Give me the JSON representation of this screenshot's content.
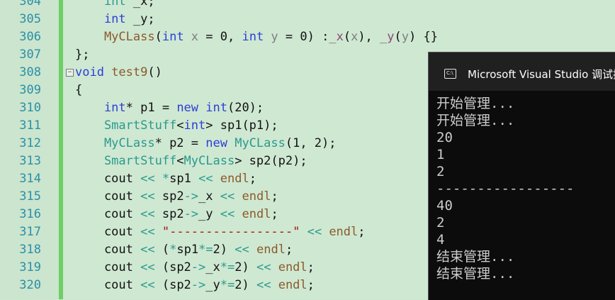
{
  "editor": {
    "lines": [
      {
        "no": "304",
        "tokens": [
          [
            "ty",
            "    int "
          ],
          [
            "pl",
            "_x;"
          ]
        ]
      },
      {
        "no": "305",
        "tokens": [
          [
            "kw",
            "    int "
          ],
          [
            "pl",
            "_y;"
          ]
        ]
      },
      {
        "no": "306",
        "tokens": [
          [
            "fn",
            "    MyCLass"
          ],
          [
            "pl",
            "("
          ],
          [
            "kw",
            "int "
          ],
          [
            "pm",
            "x"
          ],
          [
            "pl",
            " = 0, "
          ],
          [
            "kw",
            "int "
          ],
          [
            "pm",
            "y"
          ],
          [
            "pl",
            " = 0) :"
          ],
          [
            "mb",
            "_x"
          ],
          [
            "pl",
            "("
          ],
          [
            "pm",
            "x"
          ],
          [
            "pl",
            "), "
          ],
          [
            "mb",
            "_y"
          ],
          [
            "pl",
            "("
          ],
          [
            "pm",
            "y"
          ],
          [
            "pl",
            ") {}"
          ]
        ]
      },
      {
        "no": "307",
        "tokens": [
          [
            "pl",
            "};"
          ]
        ]
      },
      {
        "no": "308",
        "tokens": [
          [
            "kw",
            "void "
          ],
          [
            "fn",
            "test9"
          ],
          [
            "pl",
            "()"
          ]
        ]
      },
      {
        "no": "309",
        "tokens": [
          [
            "pl",
            "{"
          ]
        ]
      },
      {
        "no": "310",
        "tokens": [
          [
            "kw",
            "    int"
          ],
          [
            "pl",
            "* p1 = "
          ],
          [
            "kw",
            "new int"
          ],
          [
            "pl",
            "(20);"
          ]
        ]
      },
      {
        "no": "311",
        "tokens": [
          [
            "ty",
            "    SmartStuff"
          ],
          [
            "pl",
            "<"
          ],
          [
            "kw",
            "int"
          ],
          [
            "pl",
            "> sp1(p1);"
          ]
        ]
      },
      {
        "no": "312",
        "tokens": [
          [
            "ty",
            "    MyCLass"
          ],
          [
            "pl",
            "* p2 = "
          ],
          [
            "kw",
            "new "
          ],
          [
            "ty",
            "MyCLass"
          ],
          [
            "pl",
            "(1, 2);"
          ]
        ]
      },
      {
        "no": "313",
        "tokens": [
          [
            "ty",
            "    SmartStuff"
          ],
          [
            "pl",
            "<"
          ],
          [
            "ty",
            "MyCLass"
          ],
          [
            "pl",
            "> sp2(p2);"
          ]
        ]
      },
      {
        "no": "314",
        "tokens": [
          [
            "pl",
            "    cout "
          ],
          [
            "ty",
            "<<"
          ],
          [
            "pl",
            " "
          ],
          [
            "ty",
            "*"
          ],
          [
            "pl",
            "sp1 "
          ],
          [
            "ty",
            "<<"
          ],
          [
            "pl",
            " "
          ],
          [
            "fn",
            "endl"
          ],
          [
            "pl",
            ";"
          ]
        ]
      },
      {
        "no": "315",
        "tokens": [
          [
            "pl",
            "    cout "
          ],
          [
            "ty",
            "<<"
          ],
          [
            "pl",
            " sp2"
          ],
          [
            "ty",
            "->"
          ],
          [
            "pl",
            "_x "
          ],
          [
            "ty",
            "<<"
          ],
          [
            "pl",
            " "
          ],
          [
            "fn",
            "endl"
          ],
          [
            "pl",
            ";"
          ]
        ]
      },
      {
        "no": "316",
        "tokens": [
          [
            "pl",
            "    cout "
          ],
          [
            "ty",
            "<<"
          ],
          [
            "pl",
            " sp2"
          ],
          [
            "ty",
            "->"
          ],
          [
            "pl",
            "_y "
          ],
          [
            "ty",
            "<<"
          ],
          [
            "pl",
            " "
          ],
          [
            "fn",
            "endl"
          ],
          [
            "pl",
            ";"
          ]
        ]
      },
      {
        "no": "317",
        "tokens": [
          [
            "pl",
            "    cout "
          ],
          [
            "ty",
            "<<"
          ],
          [
            "pl",
            " "
          ],
          [
            "st",
            "\"-----------------\""
          ],
          [
            "pl",
            " "
          ],
          [
            "ty",
            "<<"
          ],
          [
            "pl",
            " "
          ],
          [
            "fn",
            "endl"
          ],
          [
            "pl",
            ";"
          ]
        ]
      },
      {
        "no": "318",
        "tokens": [
          [
            "pl",
            "    cout "
          ],
          [
            "ty",
            "<<"
          ],
          [
            "pl",
            " ("
          ],
          [
            "ty",
            "*"
          ],
          [
            "pl",
            "sp1"
          ],
          [
            "ty",
            "*="
          ],
          [
            "pl",
            "2) "
          ],
          [
            "ty",
            "<<"
          ],
          [
            "pl",
            " "
          ],
          [
            "fn",
            "endl"
          ],
          [
            "pl",
            ";"
          ]
        ]
      },
      {
        "no": "319",
        "tokens": [
          [
            "pl",
            "    cout "
          ],
          [
            "ty",
            "<<"
          ],
          [
            "pl",
            " (sp2"
          ],
          [
            "ty",
            "->"
          ],
          [
            "pl",
            "_x"
          ],
          [
            "ty",
            "*="
          ],
          [
            "pl",
            "2) "
          ],
          [
            "ty",
            "<<"
          ],
          [
            "pl",
            " "
          ],
          [
            "fn",
            "endl"
          ],
          [
            "pl",
            ";"
          ]
        ]
      },
      {
        "no": "320",
        "tokens": [
          [
            "pl",
            "    cout "
          ],
          [
            "ty",
            "<<"
          ],
          [
            "pl",
            " (sp2"
          ],
          [
            "ty",
            "->"
          ],
          [
            "pl",
            "_y"
          ],
          [
            "ty",
            "*="
          ],
          [
            "pl",
            "2) "
          ],
          [
            "ty",
            "<<"
          ],
          [
            "pl",
            " "
          ],
          [
            "fn",
            "endl"
          ],
          [
            "pl",
            ";"
          ]
        ]
      }
    ],
    "collapse_glyph": "−",
    "colors": {
      "background": "#cfe8d2",
      "change_bar": "#6dcf66",
      "line_numbers": "#2b8fa8"
    }
  },
  "console": {
    "icon_text": "C:\\",
    "title": "Microsoft Visual Studio 调试控制台",
    "output": [
      "开始管理...",
      "开始管理...",
      "20",
      "1",
      "2",
      "-----------------",
      "40",
      "2",
      "4",
      "结束管理...",
      "结束管理..."
    ],
    "colors": {
      "background": "#0c0c0c",
      "title_bar": "#202020",
      "text": "#cccccc"
    }
  }
}
